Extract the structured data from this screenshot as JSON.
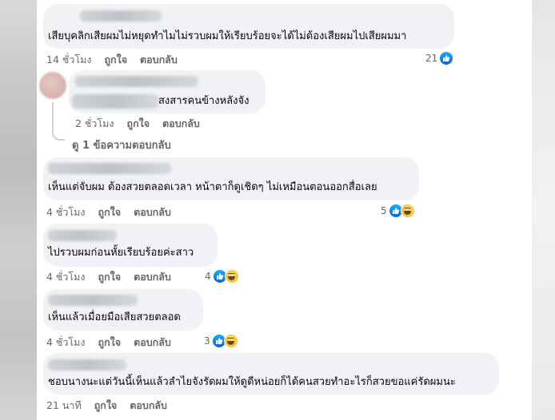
{
  "comments": [
    {
      "text": "เสียบุคลิกเสียผมไม่หยุดทำไมไม่รวบผมให้เรียบร้อยจะได้ไม่ต้องเสียผมไปเสียผมมา",
      "time": "14 ชั่วโมง",
      "like": "ถูกใจ",
      "reply": "ตอบกลับ",
      "reactions": "21"
    },
    {
      "text": "สงสารคนข้างหลังจัง",
      "time": "2 ชั่วโมง",
      "like": "ถูกใจ",
      "reply": "ตอบกลับ",
      "view_replies": "ดู 1 ข้อความตอบกลับ"
    },
    {
      "text": "เห็นแต่จับผม ต้องสวยตลอดเวลา หน้าตาก็ดูเชิดๆ ไม่เหมือนตอนออกสื่อเลย",
      "time": "4 ชั่วโมง",
      "like": "ถูกใจ",
      "reply": "ตอบกลับ",
      "reactions": "5"
    },
    {
      "text": "ไปรวบผมก่อนหั้ยเรียบร้อยค่ะสาว",
      "time": "4 ชั่วโมง",
      "like": "ถูกใจ",
      "reply": "ตอบกลับ",
      "reactions": "4"
    },
    {
      "text": "เห็นแล้วเมื่อยมือเสียสวยตลอด",
      "time": "4 ชั่วโมง",
      "like": "ถูกใจ",
      "reply": "ตอบกลับ",
      "reactions": "3"
    },
    {
      "text": "ชอบนางนะแต่วันนี้เห็นแล้วลำไยจังรัดผมให้ดูดีหน่อยก็ได้คนสวยทำอะไรก็สวยขอแค่รัดผมนะ",
      "time": "21 นาที",
      "like": "ถูกใจ",
      "reply": "ตอบกลับ"
    }
  ],
  "colors": {
    "bubble": "#f0f2f5",
    "meta": "#65676b",
    "like": "#1877f2"
  },
  "icons": {
    "like": "like-reaction-icon",
    "haha": "haha-reaction-icon"
  }
}
